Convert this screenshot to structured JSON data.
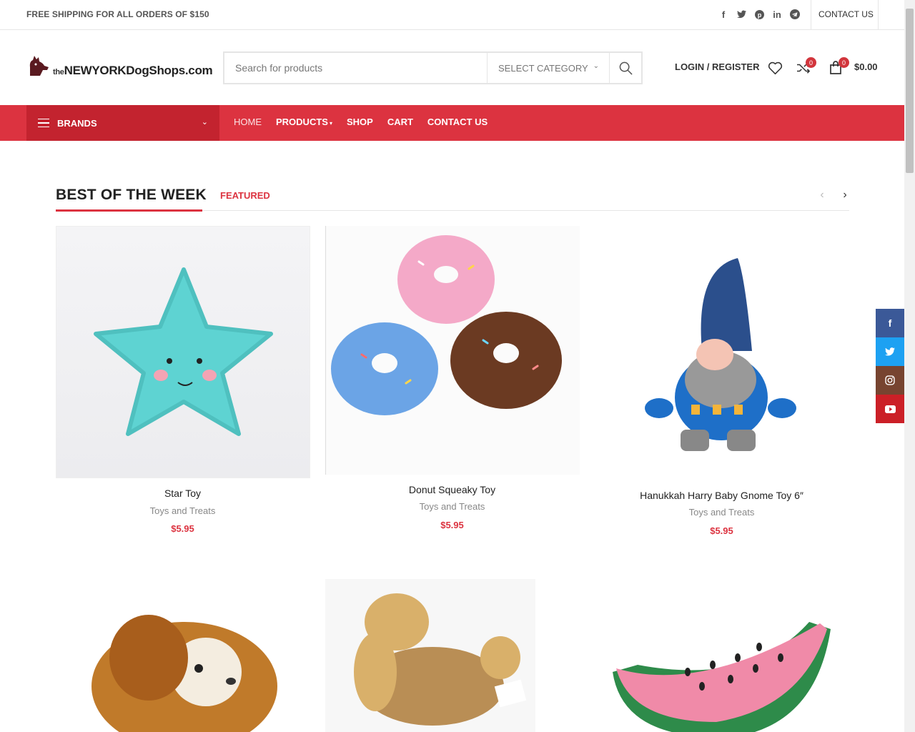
{
  "topbar": {
    "shipping_text": "FREE SHIPPING FOR ALL ORDERS OF $150",
    "social_icons": [
      "facebook-icon",
      "twitter-icon",
      "pinterest-icon",
      "linkedin-icon",
      "telegram-icon"
    ],
    "contact_label": "CONTACT US"
  },
  "header": {
    "logo_the": "the",
    "logo_text": "NEWYORKDogShops.com",
    "search_placeholder": "Search for products",
    "category_label": "SELECT CATEGORY",
    "login_label": "LOGIN / REGISTER",
    "compare_count": "0",
    "cart_count": "0",
    "cart_total": "$0.00"
  },
  "nav": {
    "brands_label": "BRANDS",
    "links": [
      "HOME",
      "PRODUCTS",
      "SHOP",
      "CART",
      "CONTACT US"
    ]
  },
  "section": {
    "title": "BEST OF THE WEEK",
    "tab_featured": "FEATURED"
  },
  "products": [
    {
      "name": "Star Toy",
      "category": "Toys and Treats",
      "price": "$5.95"
    },
    {
      "name": "Donut Squeaky Toy",
      "category": "Toys and Treats",
      "price": "$5.95"
    },
    {
      "name": "Hanukkah Harry Baby Gnome Toy 6″",
      "category": "Toys and Treats",
      "price": "$5.95"
    }
  ],
  "floating_social": [
    "facebook-icon",
    "twitter-icon",
    "instagram-icon",
    "youtube-icon"
  ],
  "colors": {
    "accent": "#dc3340",
    "accent_dark": "#c3232f",
    "facebook": "#3b5998",
    "twitter": "#1da1f2",
    "instagram": "#774430",
    "youtube": "#cb2027"
  }
}
